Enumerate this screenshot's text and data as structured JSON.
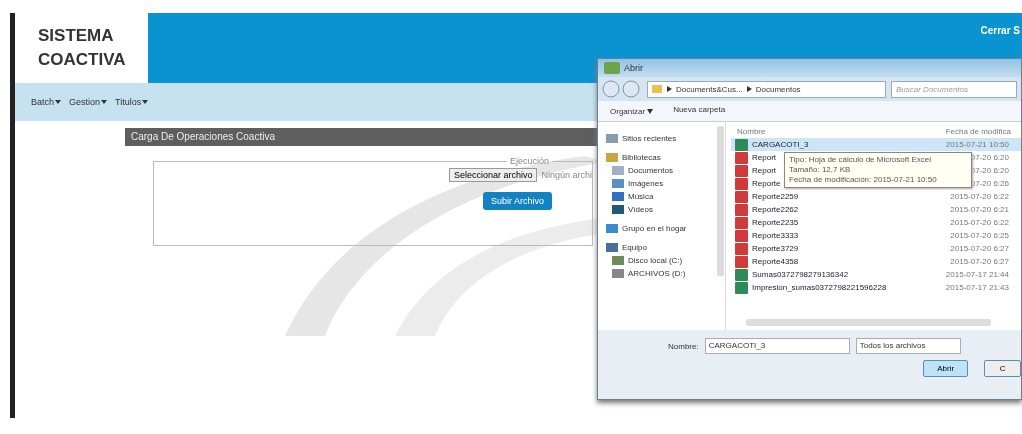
{
  "header": {
    "logo_lines": [
      "SISTEMA",
      "COACTIVA"
    ],
    "logout": "Cerrar S"
  },
  "nav": [
    {
      "label": "Batch"
    },
    {
      "label": "Gestion"
    },
    {
      "label": "Titulos"
    }
  ],
  "panel": {
    "title": "Carga De Operaciones Coactiva",
    "legend": "Ejecución",
    "file_button": "Seleccionar archivo",
    "file_status": "Ningún archi",
    "upload_button": "Subir Archivo"
  },
  "dialog": {
    "title": "Abrir",
    "path": [
      "Documents&Cus...",
      "Documentos"
    ],
    "search_placeholder": "Buscar Documentos",
    "organize": "Organizar",
    "new_folder": "Nueva carpeta",
    "sidebar": [
      {
        "label": "Sitios recientes",
        "kind": "recent"
      },
      {
        "label": "Bibliotecas",
        "kind": "library",
        "children": [
          {
            "label": "Documentos",
            "kind": "docs"
          },
          {
            "label": "Imágenes",
            "kind": "images"
          },
          {
            "label": "Música",
            "kind": "music"
          },
          {
            "label": "Vídeos",
            "kind": "video"
          }
        ]
      },
      {
        "label": "Grupo en el hogar",
        "kind": "home"
      },
      {
        "label": "Equipo",
        "kind": "computer",
        "children": [
          {
            "label": "Disco local (C:)",
            "kind": "drive"
          },
          {
            "label": "ARCHIVOS (D:)",
            "kind": "netdrive"
          }
        ]
      }
    ],
    "columns": [
      "Nombre",
      "Fecha de modifica"
    ],
    "files": [
      {
        "name": "CARGACOTI_3",
        "date": "2015-07-21 10:50",
        "kind": "excel",
        "selected": true
      },
      {
        "name": "Report",
        "date": "07-20 6:20",
        "kind": "pdf",
        "selected": false
      },
      {
        "name": "Report",
        "date": "07-20 6:20",
        "kind": "pdf",
        "selected": false
      },
      {
        "name": "Reporte",
        "date": "07-20 6:26",
        "kind": "pdf",
        "selected": false
      },
      {
        "name": "Reporte2259",
        "date": "2015-07-20 6:22",
        "kind": "pdf",
        "selected": false
      },
      {
        "name": "Reporte2262",
        "date": "2015-07-20 6:21",
        "kind": "pdf",
        "selected": false
      },
      {
        "name": "Reporte2235",
        "date": "2015-07-20 6:22",
        "kind": "pdf",
        "selected": false
      },
      {
        "name": "Reporte3333",
        "date": "2015-07-20 6:25",
        "kind": "pdf",
        "selected": false
      },
      {
        "name": "Reporte3729",
        "date": "2015-07-20 6:27",
        "kind": "pdf",
        "selected": false
      },
      {
        "name": "Reporte4358",
        "date": "2015-07-20 6:27",
        "kind": "pdf",
        "selected": false
      },
      {
        "name": "Sumas0372798279136342",
        "date": "2015-07-17 21:44",
        "kind": "excel",
        "selected": false
      },
      {
        "name": "Impresion_sumas0372798221596228",
        "date": "2015-07-17 21:43",
        "kind": "excel",
        "selected": false
      }
    ],
    "tooltip": [
      "Tipo: Hoja de cálculo de Microsoft Excel",
      "Tamaño: 12,7 KB",
      "Fecha de modificación: 2015-07-21 10:50"
    ],
    "filename_label": "Nombre:",
    "filename": "CARGACOTI_3",
    "filter": "Todos los archivos",
    "open_button": "Abrir",
    "cancel_button": "C"
  }
}
